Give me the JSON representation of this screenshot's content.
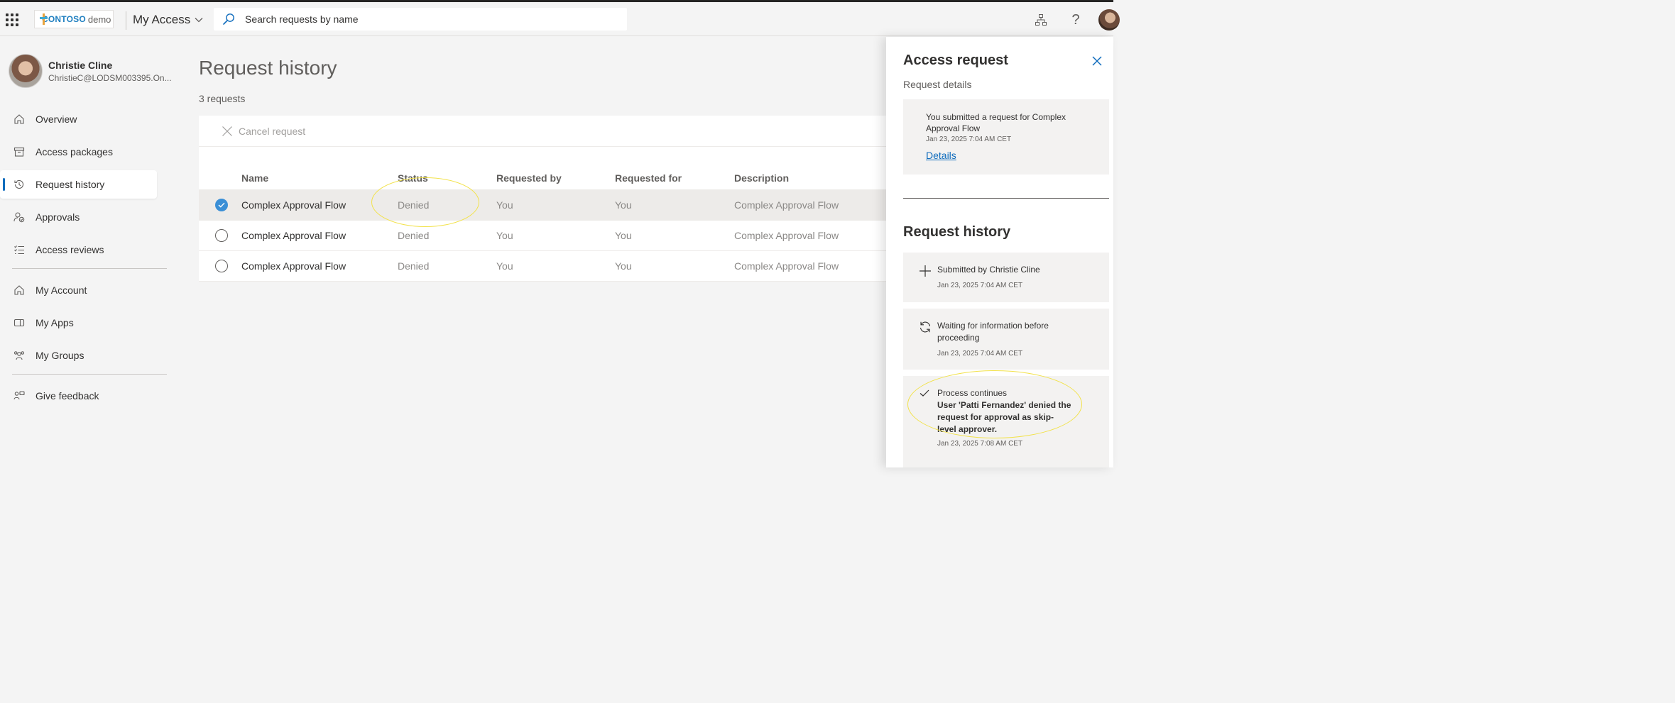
{
  "topbar": {
    "brand_name": "CONTOSO",
    "brand_suffix": "demo",
    "app_title": "My Access",
    "search_placeholder": "Search requests by name",
    "icons": [
      "app-launcher-icon",
      "org-chart-icon",
      "help-icon",
      "user-avatar"
    ]
  },
  "profile": {
    "name": "Christie Cline",
    "email": "ChristieC@LODSM003395.On..."
  },
  "sidebar": {
    "items": [
      {
        "label": "Overview",
        "icon": "home-icon"
      },
      {
        "label": "Access packages",
        "icon": "package-icon"
      },
      {
        "label": "Request history",
        "icon": "history-icon",
        "active": true
      },
      {
        "label": "Approvals",
        "icon": "approvals-icon"
      },
      {
        "label": "Access reviews",
        "icon": "checklist-icon"
      }
    ],
    "items2": [
      {
        "label": "My Account",
        "icon": "home-icon"
      },
      {
        "label": "My Apps",
        "icon": "apps-icon"
      },
      {
        "label": "My Groups",
        "icon": "groups-icon"
      }
    ],
    "items3": [
      {
        "label": "Give feedback",
        "icon": "feedback-icon"
      }
    ]
  },
  "main": {
    "title": "Request history",
    "count": "3 requests",
    "toolbar": {
      "cancel_label": "Cancel request"
    },
    "columns": [
      "Name",
      "Status",
      "Requested by",
      "Requested for",
      "Description"
    ],
    "rows": [
      {
        "name": "Complex Approval Flow",
        "status": "Denied",
        "requested_by": "You",
        "requested_for": "You",
        "description": "Complex Approval Flow",
        "selected": true
      },
      {
        "name": "Complex Approval Flow",
        "status": "Denied",
        "requested_by": "You",
        "requested_for": "You",
        "description": "Complex Approval Flow",
        "selected": false
      },
      {
        "name": "Complex Approval Flow",
        "status": "Denied",
        "requested_by": "You",
        "requested_for": "You",
        "description": "Complex Approval Flow",
        "selected": false
      }
    ]
  },
  "panel": {
    "title": "Access request",
    "subtitle": "Request details",
    "details_card": {
      "message": "You submitted a request for Complex Approval Flow",
      "timestamp": "Jan 23, 2025 7:04 AM CET",
      "link": "Details"
    },
    "history_title": "Request history",
    "history": [
      {
        "icon": "plus-icon",
        "message": "Submitted by Christie Cline",
        "detail": "",
        "timestamp": "Jan 23, 2025 7:04 AM CET"
      },
      {
        "icon": "sync-icon",
        "message": "Waiting for information before proceeding",
        "detail": "",
        "timestamp": "Jan 23, 2025 7:04 AM CET"
      },
      {
        "icon": "checkmark-icon",
        "message": "Process continues",
        "detail": "User 'Patti Fernandez' denied the request for approval as skip-level approver.",
        "timestamp": "Jan 23, 2025 7:08 AM CET"
      }
    ]
  },
  "colors": {
    "accent": "#0f6cbd",
    "selected_radio": "#3b8fd6",
    "annotation_highlight": "#f2e24a"
  }
}
